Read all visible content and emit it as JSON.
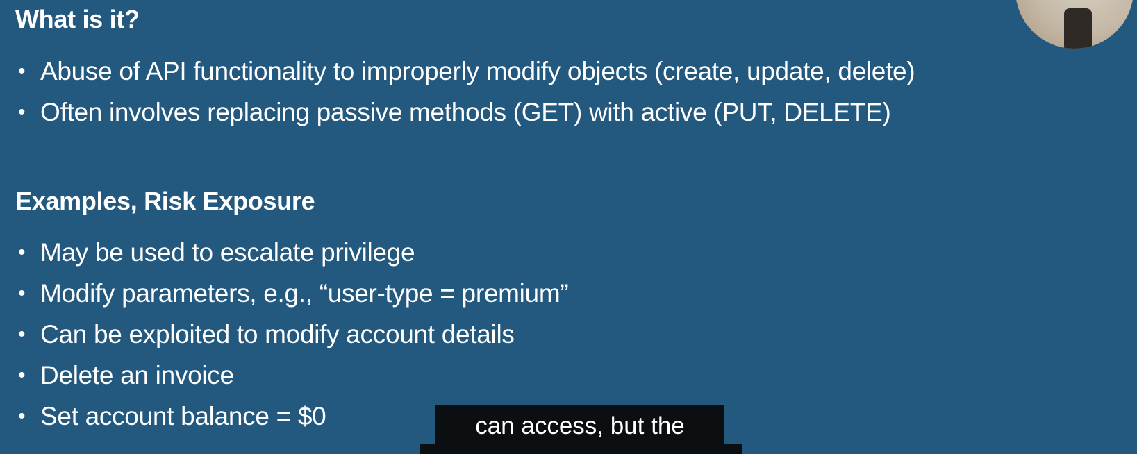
{
  "slide": {
    "section_1": {
      "heading": "What is it?",
      "bullets": [
        "Abuse of API functionality to improperly modify objects (create, update, delete)",
        "Often involves replacing passive methods (GET) with active (PUT, DELETE)"
      ]
    },
    "section_2": {
      "heading": "Examples, Risk Exposure",
      "bullets": [
        "May be used to escalate privilege",
        "Modify parameters, e.g., “user-type = premium”",
        "Can be exploited to modify account details",
        "Delete an invoice",
        "Set account balance = $0"
      ]
    },
    "bullet_glyph": "•"
  },
  "caption": {
    "text": "can access, but the"
  },
  "colors": {
    "background": "#23587f",
    "text": "#ffffff",
    "caption_background": "#0b0f12"
  }
}
